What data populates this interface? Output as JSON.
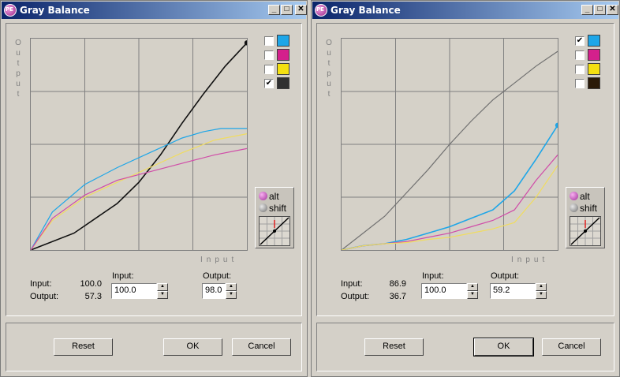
{
  "windows": [
    {
      "title": "Gray Balance",
      "axis_output": [
        "O",
        "u",
        "t",
        "p",
        "u",
        "t"
      ],
      "axis_input": "Input",
      "checkboxes": [
        {
          "checked": false,
          "color": "#1ea6e8"
        },
        {
          "checked": false,
          "color": "#d4208c"
        },
        {
          "checked": false,
          "color": "#f4e010"
        },
        {
          "checked": true,
          "color": "#303030"
        }
      ],
      "mods": {
        "alt": "alt",
        "shift": "shift"
      },
      "readout": {
        "input_label": "Input:",
        "input_value": "100.0",
        "output_label": "Output:",
        "output_value": "57.3"
      },
      "fields": {
        "input_label": "Input:",
        "input_value": "100.0",
        "output_label": "Output:",
        "output_value": "98.0"
      },
      "buttons": {
        "reset": "Reset",
        "ok": "OK",
        "cancel": "Cancel"
      },
      "curves": {
        "black": [
          [
            0,
            0
          ],
          [
            20,
            8
          ],
          [
            40,
            22
          ],
          [
            50,
            32
          ],
          [
            60,
            45
          ],
          [
            70,
            60
          ],
          [
            80,
            74
          ],
          [
            90,
            87
          ],
          [
            100,
            98
          ]
        ],
        "cyan": [
          [
            0,
            0
          ],
          [
            10,
            18
          ],
          [
            25,
            31
          ],
          [
            40,
            39
          ],
          [
            55,
            46
          ],
          [
            70,
            53
          ],
          [
            80,
            56
          ],
          [
            88,
            57.5
          ],
          [
            100,
            57.5
          ]
        ],
        "yellow": [
          [
            0,
            0
          ],
          [
            10,
            14
          ],
          [
            25,
            25
          ],
          [
            40,
            32
          ],
          [
            55,
            39
          ],
          [
            70,
            46
          ],
          [
            85,
            52
          ],
          [
            100,
            55
          ]
        ],
        "magenta": [
          [
            0,
            0
          ],
          [
            10,
            15
          ],
          [
            25,
            26
          ],
          [
            40,
            33
          ],
          [
            55,
            37
          ],
          [
            70,
            41
          ],
          [
            85,
            45
          ],
          [
            100,
            48
          ]
        ]
      }
    },
    {
      "title": "Gray Balance",
      "axis_output": [
        "O",
        "u",
        "t",
        "p",
        "u",
        "t"
      ],
      "axis_input": "Input",
      "checkboxes": [
        {
          "checked": true,
          "color": "#1ea6e8"
        },
        {
          "checked": false,
          "color": "#d4208c"
        },
        {
          "checked": false,
          "color": "#f4e010"
        },
        {
          "checked": false,
          "color": "#2a1a08"
        }
      ],
      "mods": {
        "alt": "alt",
        "shift": "shift"
      },
      "readout": {
        "input_label": "Input:",
        "input_value": "86.9",
        "output_label": "Output:",
        "output_value": "36.7"
      },
      "fields": {
        "input_label": "Input:",
        "input_value": "100.0",
        "output_label": "Output:",
        "output_value": "59.2"
      },
      "buttons": {
        "reset": "Reset",
        "ok": "OK",
        "cancel": "Cancel"
      },
      "curves": {
        "gray": [
          [
            0,
            0
          ],
          [
            10,
            8
          ],
          [
            20,
            16
          ],
          [
            30,
            27
          ],
          [
            40,
            38
          ],
          [
            50,
            50
          ],
          [
            60,
            61
          ],
          [
            70,
            71
          ],
          [
            80,
            79
          ],
          [
            90,
            87
          ],
          [
            100,
            94
          ]
        ],
        "cyan": [
          [
            0,
            0
          ],
          [
            10,
            2
          ],
          [
            20,
            3
          ],
          [
            30,
            5
          ],
          [
            40,
            8
          ],
          [
            50,
            11
          ],
          [
            60,
            15
          ],
          [
            70,
            19
          ],
          [
            80,
            28
          ],
          [
            90,
            43
          ],
          [
            100,
            59
          ]
        ],
        "magenta": [
          [
            0,
            0
          ],
          [
            10,
            2
          ],
          [
            20,
            3
          ],
          [
            30,
            4
          ],
          [
            40,
            6
          ],
          [
            50,
            8
          ],
          [
            60,
            11
          ],
          [
            70,
            14
          ],
          [
            80,
            19
          ],
          [
            90,
            33
          ],
          [
            100,
            45
          ]
        ],
        "yellow": [
          [
            0,
            0
          ],
          [
            10,
            2
          ],
          [
            20,
            3
          ],
          [
            30,
            3.5
          ],
          [
            40,
            5
          ],
          [
            50,
            6
          ],
          [
            60,
            8
          ],
          [
            70,
            10
          ],
          [
            80,
            13
          ],
          [
            90,
            25
          ],
          [
            100,
            40
          ]
        ]
      }
    }
  ],
  "curve_colors": {
    "black": "#101010",
    "gray": "#707070",
    "cyan": "#1ea6e8",
    "magenta": "#d04ca8",
    "yellow": "#f0dc60"
  }
}
